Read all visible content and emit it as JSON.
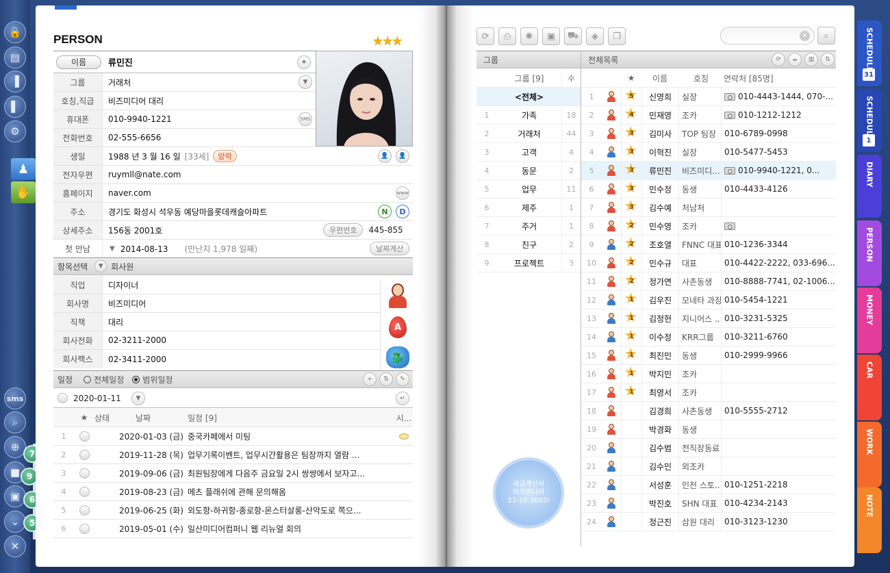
{
  "left_panel": {
    "sms_label": "sms"
  },
  "person": {
    "title": "PERSON",
    "rating_stars": 3,
    "name_button": "이름",
    "name": "류민진",
    "fields": [
      {
        "label": "그룹",
        "value": "거래처"
      },
      {
        "label": "호칭,직급",
        "value": "비즈미디어 대리"
      },
      {
        "label": "휴대폰",
        "value": "010-9940-1221"
      },
      {
        "label": "전화번호",
        "value": "02-555-6656"
      },
      {
        "label": "생일",
        "value": "1988 년 3 월 16 일"
      },
      {
        "label": "전자우편",
        "value": "ruymll@nate.com"
      },
      {
        "label": "홈페이지",
        "value": "naver.com"
      },
      {
        "label": "주소",
        "value": "경기도 화성시 석우동 예당마을롯데캐슬아파트"
      },
      {
        "label": "상세주소",
        "value": "156동 2001호"
      },
      {
        "label": "첫 만남",
        "value": "2014-08-13"
      }
    ],
    "sms_button": "SMS",
    "age": "[33세]",
    "lunar_button": "양력",
    "www_button": "www",
    "naver_button": "N",
    "daum_button": "D",
    "zip_button": "우편번호",
    "zip_code": "445-855",
    "met_days": "(만난지 1,978 일째)",
    "date_calc_button": "날짜계산",
    "category_label": "항목선택",
    "category_value": "회사원",
    "company_fields": [
      {
        "label": "직업",
        "value": "디자이너"
      },
      {
        "label": "회사명",
        "value": "비즈미디어"
      },
      {
        "label": "직책",
        "value": "대리"
      },
      {
        "label": "회사전화",
        "value": "02-3211-2000"
      },
      {
        "label": "회사팩스",
        "value": "02-3411-2000"
      }
    ],
    "blood_type": "A"
  },
  "schedule": {
    "label": "일정",
    "opt_all": "전체일정",
    "opt_range": "범위일정",
    "date": "2020-01-11",
    "headers": {
      "star": "★",
      "status": "상태",
      "date": "날짜",
      "title": "일정 [9]",
      "time": "시..."
    },
    "rows": [
      {
        "n": "1",
        "date": "2020-01-03 (금)",
        "title": "중국카페에서 미팅"
      },
      {
        "n": "2",
        "date": "2019-11-28 (목)",
        "title": "업무기록이벤트, 업무시간활용은 팀장까지 열람 ..."
      },
      {
        "n": "3",
        "date": "2019-09-06 (금)",
        "title": "최원팀장에게 다음주 금요일 2시 쌍쌍에서 보자고..."
      },
      {
        "n": "4",
        "date": "2019-08-23 (금)",
        "title": "메츠 플래쉬에 관해 문의해옴"
      },
      {
        "n": "5",
        "date": "2019-06-25 (화)",
        "title": "외도항-하귀항-종로항-몬스터살롱-산악도로 쪽으..."
      },
      {
        "n": "6",
        "date": "2019-05-01 (수)",
        "title": "일산미디어컴퍼니 웹 리뉴얼 회의"
      }
    ]
  },
  "groups": {
    "header": "그룹",
    "col_group": "그룹 [9]",
    "col_count": "수",
    "all_label": "<전체>",
    "items": [
      {
        "n": "1",
        "name": "가족",
        "count": "18"
      },
      {
        "n": "2",
        "name": "거래처",
        "count": "44"
      },
      {
        "n": "3",
        "name": "고객",
        "count": "4"
      },
      {
        "n": "4",
        "name": "동문",
        "count": "2"
      },
      {
        "n": "5",
        "name": "업무",
        "count": "11"
      },
      {
        "n": "6",
        "name": "제주",
        "count": "1"
      },
      {
        "n": "7",
        "name": "주거",
        "count": "1"
      },
      {
        "n": "8",
        "name": "친구",
        "count": "2"
      },
      {
        "n": "9",
        "name": "프로젝트",
        "count": "3"
      }
    ]
  },
  "list": {
    "header": "전체목록",
    "col_star": "★",
    "col_name": "이름",
    "col_title": "호칭",
    "col_contact": "연락처 [85명]",
    "rows": [
      {
        "n": "1",
        "g": "f",
        "b": "5",
        "name": "신영희",
        "title": "실장",
        "phone": "010-4443-1444, 070-...",
        "cam": true
      },
      {
        "n": "2",
        "g": "f",
        "b": "4",
        "name": "민재영",
        "title": "조카",
        "phone": "010-1212-1212",
        "cam": true
      },
      {
        "n": "3",
        "g": "f",
        "b": "3",
        "name": "김미사",
        "title": "TOP 팀장",
        "phone": "010-6789-0998"
      },
      {
        "n": "4",
        "g": "m",
        "b": "3",
        "name": "이혁진",
        "title": "실장",
        "phone": "010-5477-5453"
      },
      {
        "n": "5",
        "g": "f",
        "b": "3",
        "name": "류민진",
        "title": "비즈미디...",
        "phone": "010-9940-1221, 0...",
        "cam": true,
        "sel": true
      },
      {
        "n": "6",
        "g": "f",
        "b": "3",
        "name": "민수정",
        "title": "동생",
        "phone": "010-4433-4126"
      },
      {
        "n": "7",
        "g": "f",
        "b": "3",
        "name": "김수예",
        "title": "처남처",
        "phone": ""
      },
      {
        "n": "8",
        "g": "f",
        "b": "2",
        "name": "민수영",
        "title": "조카",
        "phone": "",
        "cam": true
      },
      {
        "n": "9",
        "g": "m",
        "b": "2",
        "name": "조호열",
        "title": "FNNC 대표",
        "phone": "010-1236-3344"
      },
      {
        "n": "10",
        "g": "f",
        "b": "2",
        "name": "민수규",
        "title": "대표",
        "phone": "010-4422-2222, 033-696..."
      },
      {
        "n": "11",
        "g": "f",
        "b": "2",
        "name": "정가연",
        "title": "사촌동생",
        "phone": "010-8888-7741, 02-1006..."
      },
      {
        "n": "12",
        "g": "m",
        "b": "1",
        "name": "김우진",
        "title": "모네타 과장",
        "phone": "010-5454-1221"
      },
      {
        "n": "13",
        "g": "m",
        "b": "1",
        "name": "김정헌",
        "title": "지니어스 ...",
        "phone": "010-3231-5325"
      },
      {
        "n": "14",
        "g": "m",
        "b": "1",
        "name": "이수정",
        "title": "KRR그룹",
        "phone": "010-3211-6760"
      },
      {
        "n": "15",
        "g": "f",
        "b": "1",
        "name": "최진민",
        "title": "동생",
        "phone": "010-2999-9966"
      },
      {
        "n": "16",
        "g": "f",
        "b": "1",
        "name": "박지민",
        "title": "조카",
        "phone": ""
      },
      {
        "n": "17",
        "g": "f",
        "b": "1",
        "name": "최영서",
        "title": "조카",
        "phone": ""
      },
      {
        "n": "18",
        "g": "f",
        "b": "",
        "name": "김경희",
        "title": "사촌동생",
        "phone": "010-5555-2712"
      },
      {
        "n": "19",
        "g": "f",
        "b": "",
        "name": "박경화",
        "title": "동생",
        "phone": ""
      },
      {
        "n": "20",
        "g": "m",
        "b": "",
        "name": "김수범",
        "title": "전직장동료",
        "phone": ""
      },
      {
        "n": "21",
        "g": "m",
        "b": "",
        "name": "김수민",
        "title": "외조카",
        "phone": ""
      },
      {
        "n": "22",
        "g": "m",
        "b": "",
        "name": "서성훈",
        "title": "인천 스토...",
        "phone": "010-1251-2218"
      },
      {
        "n": "23",
        "g": "m",
        "b": "",
        "name": "박진호",
        "title": "SHN 대표",
        "phone": "010-4234-2143"
      },
      {
        "n": "24",
        "g": "m",
        "b": "",
        "name": "정근진",
        "title": "삼원 대리",
        "phone": "010-3123-1230"
      }
    ]
  },
  "stamp": {
    "line1": "세금계산서",
    "line2": "비즈미디어",
    "line3": "21-10-3002l"
  },
  "tabs": [
    {
      "label": "SCHEDULE",
      "num": "31",
      "color": "#2c55c6"
    },
    {
      "label": "SCHEDULE",
      "num": "1",
      "color": "#2847b4"
    },
    {
      "label": "DIARY",
      "color": "#4b3fd8"
    },
    {
      "label": "PERSON",
      "color": "#a34be0"
    },
    {
      "label": "MONEY",
      "color": "#e43c9a"
    },
    {
      "label": "CAR",
      "color": "#f04436"
    },
    {
      "label": "WORK",
      "color": "#f46a2c"
    },
    {
      "label": "NOTE",
      "color": "#f4862a"
    }
  ],
  "dock_badges": [
    "7",
    "9",
    "6",
    "5"
  ]
}
